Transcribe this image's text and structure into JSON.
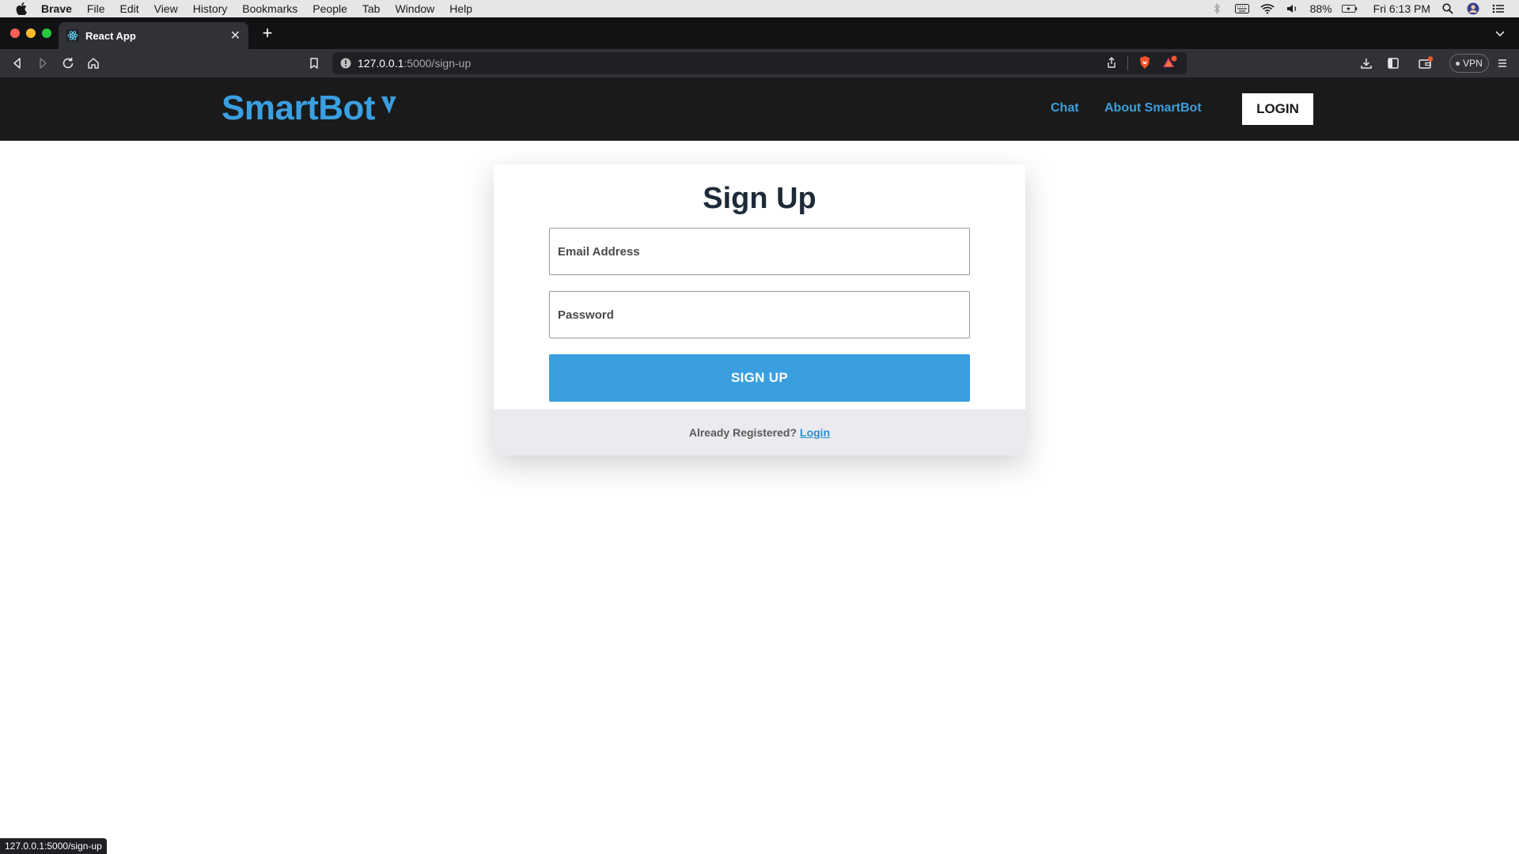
{
  "menubar": {
    "items": [
      "Brave",
      "File",
      "Edit",
      "View",
      "History",
      "Bookmarks",
      "People",
      "Tab",
      "Window",
      "Help"
    ],
    "battery": "88%",
    "clock": "Fri 6:13 PM"
  },
  "browser": {
    "tab_title": "React App",
    "url_host": "127.0.0.1",
    "url_path": ":5000/sign-up",
    "vpn_label": "VPN",
    "status_url": "127.0.0.1:5000/sign-up"
  },
  "site": {
    "logo_text": "SmartBot",
    "nav": [
      "Chat",
      "About SmartBot"
    ],
    "login_label": "LOGIN"
  },
  "form": {
    "title": "Sign Up",
    "email_placeholder": "Email Address",
    "password_placeholder": "Password",
    "submit_label": "SIGN UP",
    "footer_text": "Already Registered?",
    "footer_link": "Login"
  },
  "colors": {
    "brand_blue": "#3a9fe0",
    "header_bg": "#1a1a1a",
    "button_blue": "#3a9fdf"
  }
}
